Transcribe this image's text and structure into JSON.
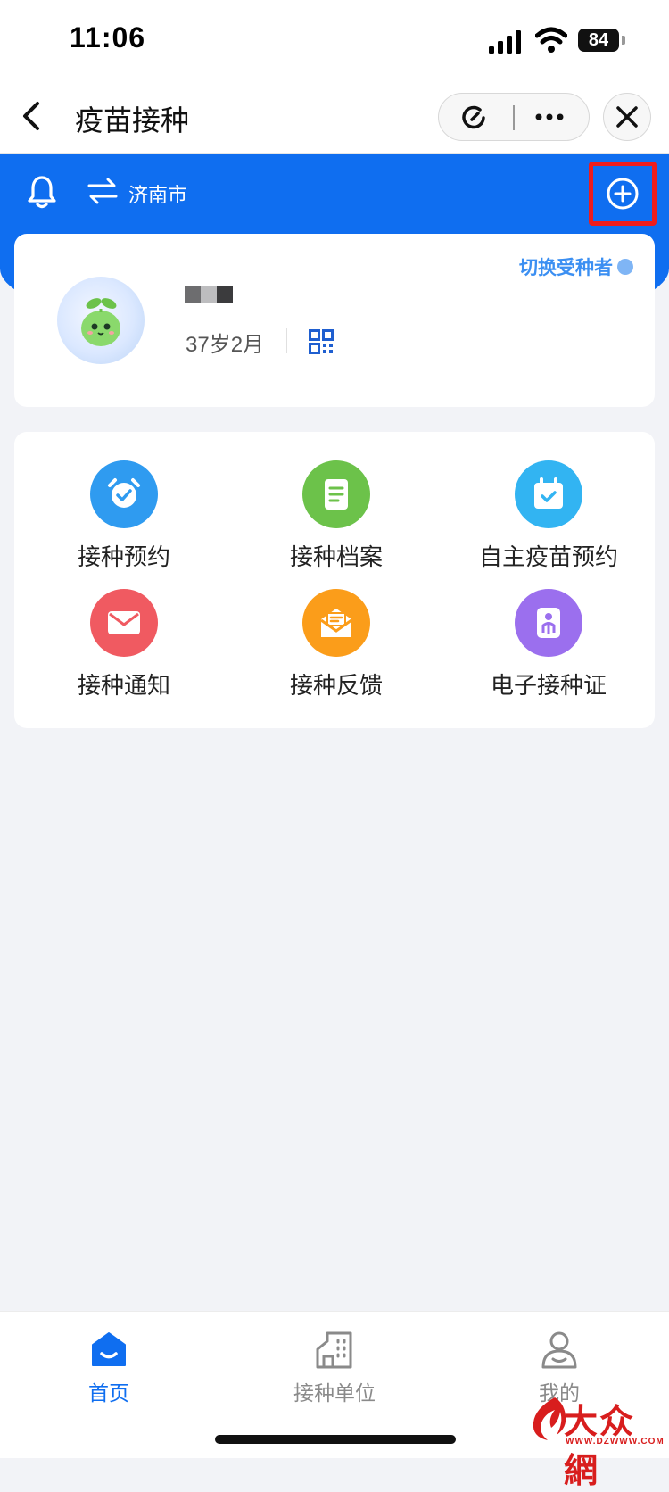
{
  "status_bar": {
    "time": "11:06",
    "battery": "84"
  },
  "nav": {
    "title": "疫苗接种"
  },
  "header": {
    "city": "济南市"
  },
  "profile": {
    "age": "37岁2月",
    "switch_label": "切换受种者"
  },
  "functions": [
    {
      "label": "接种预约",
      "icon": "alarm-clock-icon",
      "color": "#2f9bf0"
    },
    {
      "label": "接种档案",
      "icon": "document-icon",
      "color": "#6cc24a"
    },
    {
      "label": "自主疫苗预约",
      "icon": "calendar-check-icon",
      "color": "#32b4f2"
    },
    {
      "label": "接种通知",
      "icon": "envelope-icon",
      "color": "#f05a61"
    },
    {
      "label": "接种反馈",
      "icon": "open-mail-icon",
      "color": "#fb9d1a"
    },
    {
      "label": "电子接种证",
      "icon": "certificate-icon",
      "color": "#9b6fee"
    }
  ],
  "tabs": [
    {
      "label": "首页",
      "icon": "home-icon",
      "active": true
    },
    {
      "label": "接种单位",
      "icon": "building-icon",
      "active": false
    },
    {
      "label": "我的",
      "icon": "user-icon",
      "active": false
    }
  ],
  "colors": {
    "primary": "#0f6ef0",
    "highlight_box": "#ee1c1c",
    "inactive_tab": "#8a8a8a"
  },
  "watermark": {
    "text": "大众網",
    "url": "WWW.DZWWW.COM"
  }
}
